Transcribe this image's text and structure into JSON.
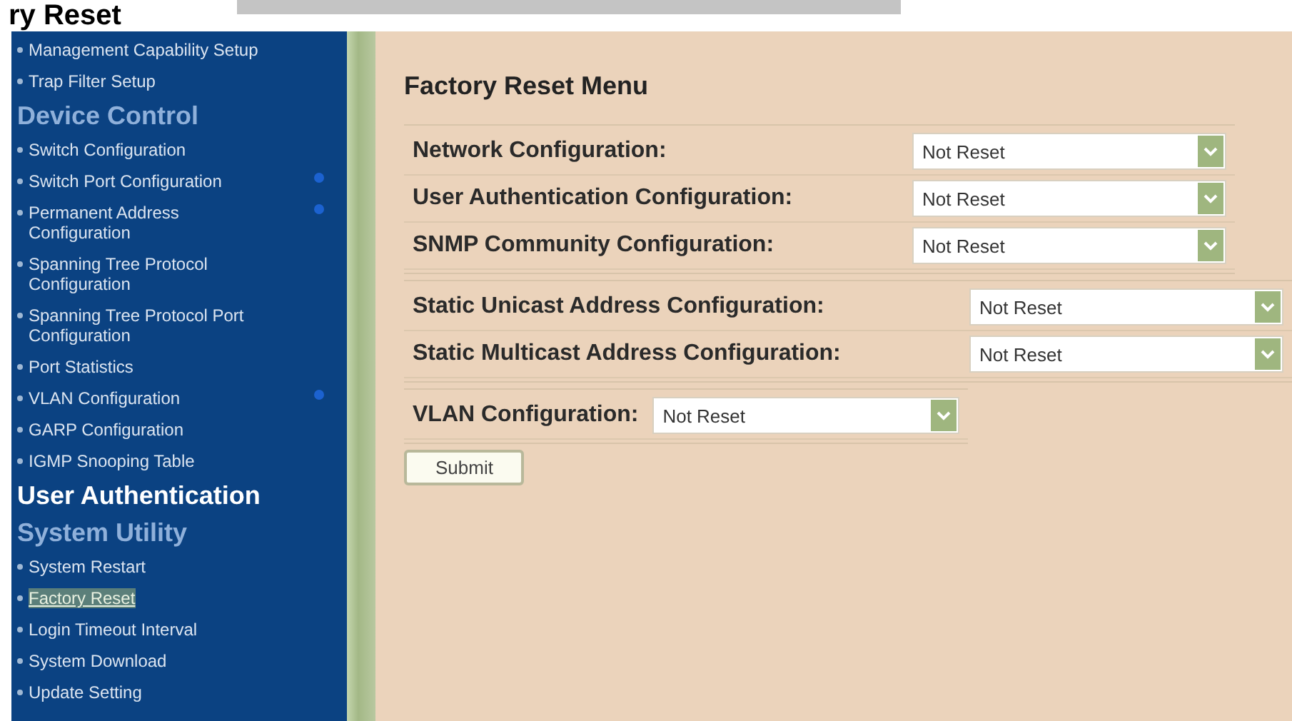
{
  "page_title": "ry Reset",
  "sidebar": {
    "items": [
      {
        "kind": "link",
        "label": "Management Capability Setup",
        "selected": false,
        "has_submenu": false
      },
      {
        "kind": "link",
        "label": "Trap Filter Setup",
        "selected": false,
        "has_submenu": false
      },
      {
        "kind": "heading",
        "label": "Device Control",
        "active": false
      },
      {
        "kind": "link",
        "label": "Switch Configuration",
        "selected": false,
        "has_submenu": false
      },
      {
        "kind": "link",
        "label": "Switch Port Configuration",
        "selected": false,
        "has_submenu": true
      },
      {
        "kind": "link",
        "label": "Permanent Address Configuration",
        "selected": false,
        "has_submenu": true
      },
      {
        "kind": "link",
        "label": "Spanning Tree Protocol Configuration",
        "selected": false,
        "has_submenu": false
      },
      {
        "kind": "link",
        "label": "Spanning Tree Protocol Port Configuration",
        "selected": false,
        "has_submenu": false
      },
      {
        "kind": "link",
        "label": "Port Statistics",
        "selected": false,
        "has_submenu": false
      },
      {
        "kind": "link",
        "label": "VLAN Configuration",
        "selected": false,
        "has_submenu": true
      },
      {
        "kind": "link",
        "label": "GARP Configuration",
        "selected": false,
        "has_submenu": false
      },
      {
        "kind": "link",
        "label": "IGMP Snooping Table",
        "selected": false,
        "has_submenu": false
      },
      {
        "kind": "heading",
        "label": "User Authentication",
        "active": true
      },
      {
        "kind": "heading",
        "label": "System Utility",
        "active": false
      },
      {
        "kind": "link",
        "label": "System Restart",
        "selected": false,
        "has_submenu": false
      },
      {
        "kind": "link",
        "label": "Factory Reset",
        "selected": true,
        "has_submenu": false
      },
      {
        "kind": "link",
        "label": "Login Timeout Interval",
        "selected": false,
        "has_submenu": false
      },
      {
        "kind": "link",
        "label": "System Download",
        "selected": false,
        "has_submenu": false
      },
      {
        "kind": "link",
        "label": "Update Setting",
        "selected": false,
        "has_submenu": false
      }
    ]
  },
  "form": {
    "title": "Factory Reset Menu",
    "groups": [
      {
        "fields": [
          {
            "label": "Network Configuration:",
            "value": "Not Reset"
          },
          {
            "label": "User Authentication Configuration:",
            "value": "Not Reset"
          },
          {
            "label": "SNMP Community Configuration:",
            "value": "Not Reset"
          }
        ]
      },
      {
        "fields": [
          {
            "label": "Static Unicast Address Configuration:",
            "value": "Not Reset"
          },
          {
            "label": "Static Multicast Address Configuration:",
            "value": "Not Reset"
          }
        ]
      },
      {
        "fields": [
          {
            "label": "VLAN Configuration:",
            "value": "Not Reset"
          }
        ]
      }
    ],
    "submit": "Submit"
  }
}
